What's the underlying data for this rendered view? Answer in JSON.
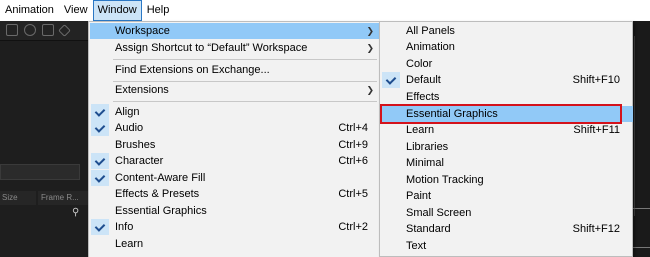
{
  "menubar": {
    "items": [
      {
        "label": "Animation"
      },
      {
        "label": "View"
      },
      {
        "label": "Window"
      },
      {
        "label": "Help"
      }
    ]
  },
  "background": {
    "columns": [
      {
        "label": "Size"
      },
      {
        "label": "Frame R..."
      }
    ]
  },
  "window_menu": {
    "items": [
      {
        "label": "Workspace",
        "shortcut": "",
        "submenu": true,
        "checked": false,
        "highlighted": true
      },
      {
        "label": "Assign Shortcut to “Default” Workspace",
        "shortcut": "",
        "submenu": true,
        "checked": false
      },
      {
        "label": "Find Extensions on Exchange...",
        "shortcut": "",
        "submenu": false,
        "checked": false
      },
      {
        "label": "Extensions",
        "shortcut": "",
        "submenu": true,
        "checked": false
      },
      {
        "label": "Align",
        "shortcut": "",
        "submenu": false,
        "checked": true
      },
      {
        "label": "Audio",
        "shortcut": "Ctrl+4",
        "submenu": false,
        "checked": true
      },
      {
        "label": "Brushes",
        "shortcut": "Ctrl+9",
        "submenu": false,
        "checked": false
      },
      {
        "label": "Character",
        "shortcut": "Ctrl+6",
        "submenu": false,
        "checked": true
      },
      {
        "label": "Content-Aware Fill",
        "shortcut": "",
        "submenu": false,
        "checked": true
      },
      {
        "label": "Effects & Presets",
        "shortcut": "Ctrl+5",
        "submenu": false,
        "checked": false
      },
      {
        "label": "Essential Graphics",
        "shortcut": "",
        "submenu": false,
        "checked": false
      },
      {
        "label": "Info",
        "shortcut": "Ctrl+2",
        "submenu": false,
        "checked": true
      },
      {
        "label": "Learn",
        "shortcut": "",
        "submenu": false,
        "checked": false
      }
    ]
  },
  "workspace_menu": {
    "items": [
      {
        "label": "All Panels",
        "shortcut": "",
        "checked": false
      },
      {
        "label": "Animation",
        "shortcut": "",
        "checked": false
      },
      {
        "label": "Color",
        "shortcut": "",
        "checked": false
      },
      {
        "label": "Default",
        "shortcut": "Shift+F10",
        "checked": true
      },
      {
        "label": "Effects",
        "shortcut": "",
        "checked": false
      },
      {
        "label": "Essential Graphics",
        "shortcut": "",
        "checked": false,
        "highlighted": true
      },
      {
        "label": "Learn",
        "shortcut": "Shift+F11",
        "checked": false
      },
      {
        "label": "Libraries",
        "shortcut": "",
        "checked": false
      },
      {
        "label": "Minimal",
        "shortcut": "",
        "checked": false
      },
      {
        "label": "Motion Tracking",
        "shortcut": "",
        "checked": false
      },
      {
        "label": "Paint",
        "shortcut": "",
        "checked": false
      },
      {
        "label": "Small Screen",
        "shortcut": "",
        "checked": false
      },
      {
        "label": "Standard",
        "shortcut": "Shift+F12",
        "checked": false
      },
      {
        "label": "Text",
        "shortcut": "",
        "checked": false
      }
    ]
  },
  "colors": {
    "highlight": "#91c9f7",
    "check_bg": "#cce4f7",
    "callout": "#d4121b"
  },
  "icons": {
    "submenu_arrow": "chevron-right-icon",
    "check": "checkmark-icon",
    "hierarchy": "hierarchy-icon"
  }
}
